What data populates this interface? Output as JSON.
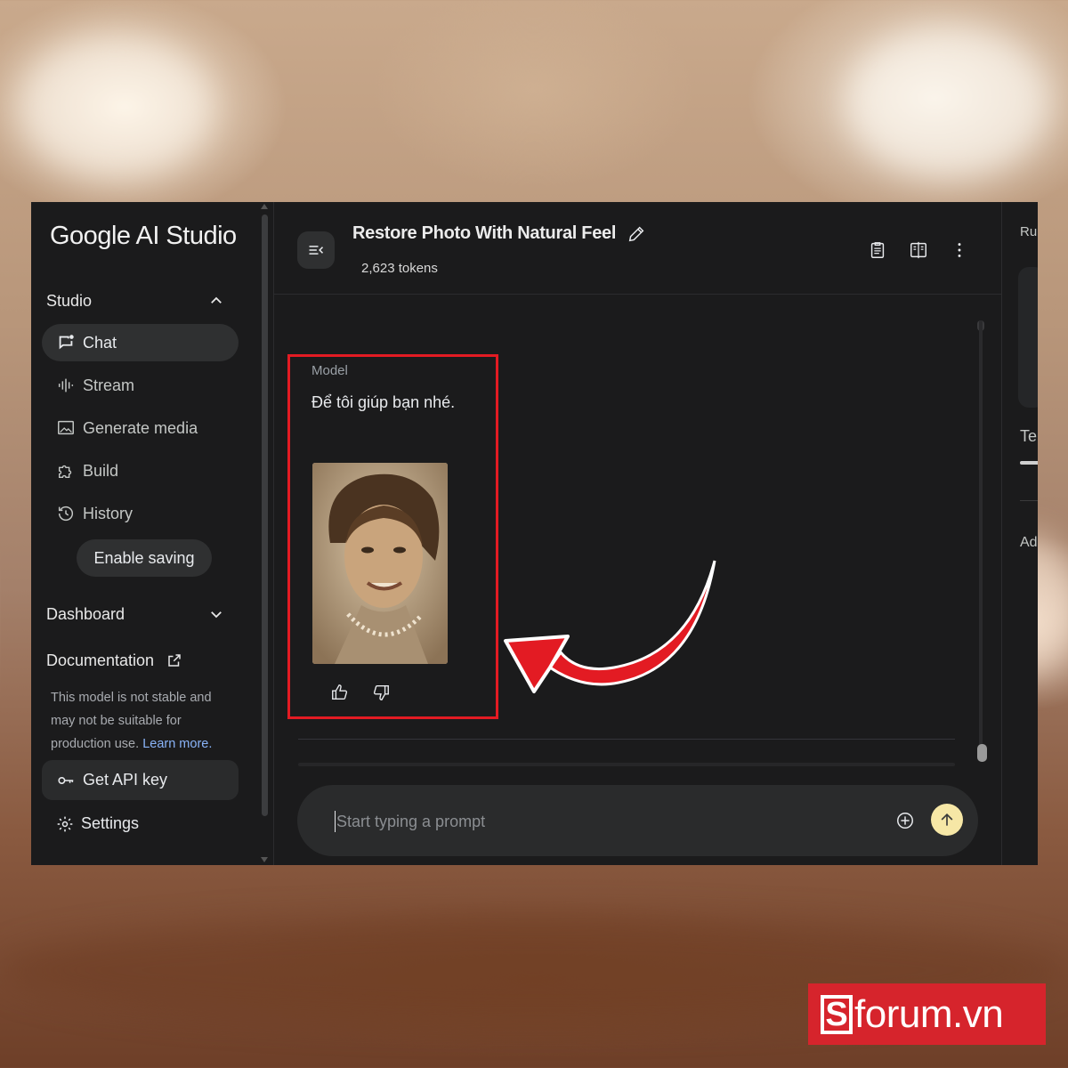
{
  "sidebar": {
    "logo": "Google AI Studio",
    "studio_label": "Studio",
    "items": [
      {
        "label": "Chat",
        "icon": "chat-icon"
      },
      {
        "label": "Stream",
        "icon": "waveform-icon"
      },
      {
        "label": "Generate media",
        "icon": "image-icon"
      },
      {
        "label": "Build",
        "icon": "puzzle-icon"
      },
      {
        "label": "History",
        "icon": "history-icon"
      }
    ],
    "enable_saving": "Enable saving",
    "dashboard_label": "Dashboard",
    "documentation_label": "Documentation",
    "disclaimer": "This model is not stable and may not be suitable for production use.",
    "learn_more": "Learn more.",
    "api_key": "Get API key",
    "settings": "Settings"
  },
  "header": {
    "title": "Restore Photo With Natural Feel",
    "tokens": "2,623 tokens"
  },
  "chat": {
    "role_label": "Model",
    "message": "Để tôi giúp bạn nhé."
  },
  "prompt": {
    "placeholder": "Start typing a prompt"
  },
  "right_panel": {
    "run_settings": "Ru",
    "temperature": "Te",
    "advanced": "Ad"
  },
  "watermark": {
    "brand_letter": "S",
    "brand_text": "forum.vn"
  },
  "colors": {
    "app_bg": "#1b1b1c",
    "active_item": "#2f3031",
    "highlight_box": "#e31b23",
    "send_button": "#f6e7a6",
    "link": "#8ab4f8",
    "watermark_bg": "#d6242c"
  }
}
